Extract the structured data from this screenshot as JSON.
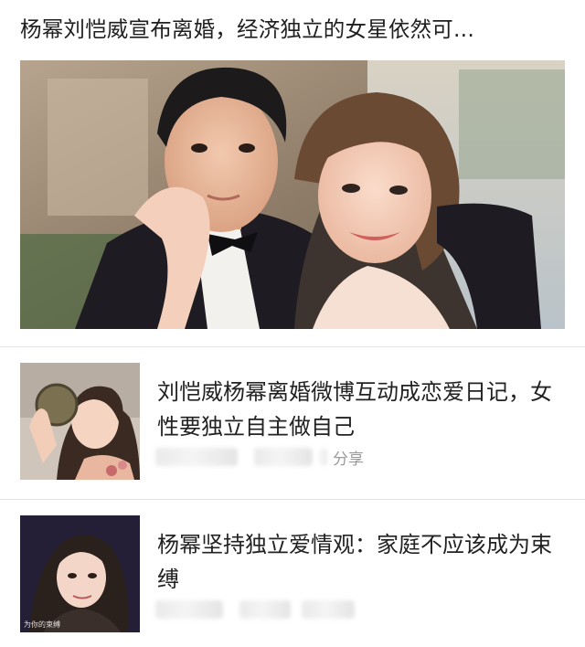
{
  "feed": {
    "headline": "杨幂刘恺威宣布离婚，经济独立的女星依然可...",
    "hero_image": "couple-wedding-photo",
    "items": [
      {
        "title": "刘恺威杨幂离婚微博互动成恋爱日记，女性要独立自主做自己",
        "thumbnail": "woman-holding-mirror-photo",
        "share_label": "分享"
      },
      {
        "title": "杨幂坚持独立爱情观：家庭不应该成为束缚",
        "thumbnail": "woman-tv-interview-photo",
        "caption": "为你的束缚"
      }
    ]
  },
  "colors": {
    "text": "#1f1f1f",
    "muted": "#9a9a9a",
    "divider": "#e3e3e3"
  }
}
